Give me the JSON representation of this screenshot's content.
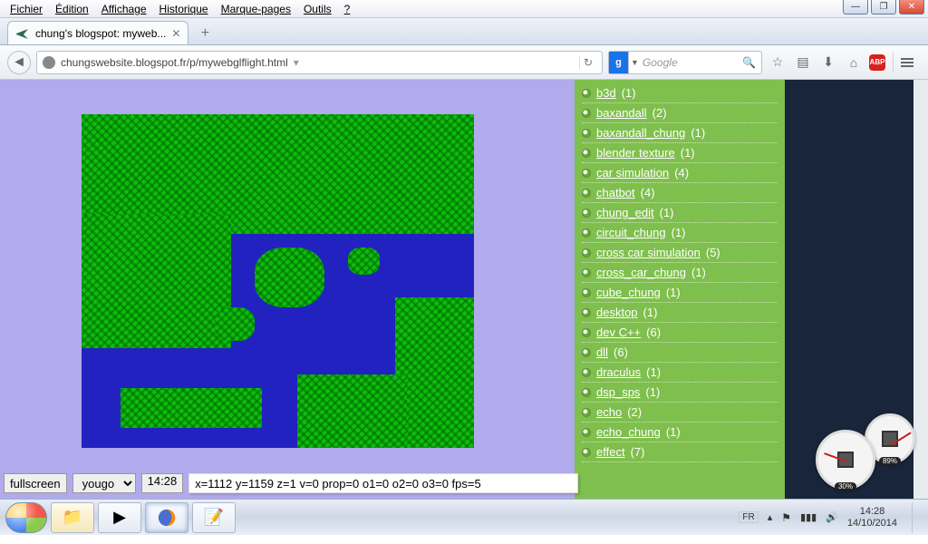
{
  "window": {
    "menus": [
      "Fichier",
      "Édition",
      "Affichage",
      "Historique",
      "Marque-pages",
      "Outils",
      "?"
    ]
  },
  "tab": {
    "title": "chung's blogspot: myweb..."
  },
  "nav": {
    "url": "chungswebsite.blogspot.fr/p/mywebglflight.html",
    "search_placeholder": "Google",
    "search_engine": "g"
  },
  "page": {
    "controls": {
      "fullscreen_label": "fullscreen",
      "select_value": "yougo",
      "time": "14:28",
      "status": "x=1112 y=1159 z=1 v=0 prop=0 o1=0 o2=0 o3=0 fps=5"
    },
    "categories": [
      {
        "label": "b3d",
        "count": "(1)"
      },
      {
        "label": "baxandall",
        "count": "(2)"
      },
      {
        "label": "baxandall_chung",
        "count": "(1)"
      },
      {
        "label": "blender texture",
        "count": "(1)"
      },
      {
        "label": "car simulation",
        "count": "(4)"
      },
      {
        "label": "chatbot",
        "count": "(4)"
      },
      {
        "label": "chung_edit",
        "count": "(1)"
      },
      {
        "label": "circuit_chung",
        "count": "(1)"
      },
      {
        "label": "cross car simulation",
        "count": "(5)"
      },
      {
        "label": "cross_car_chung",
        "count": "(1)"
      },
      {
        "label": "cube_chung",
        "count": "(1)"
      },
      {
        "label": "desktop",
        "count": "(1)"
      },
      {
        "label": "dev C++",
        "count": "(6)"
      },
      {
        "label": "dll",
        "count": "(6)"
      },
      {
        "label": "draculus",
        "count": "(1)"
      },
      {
        "label": "dsp_sps",
        "count": "(1)"
      },
      {
        "label": "echo",
        "count": "(2)"
      },
      {
        "label": "echo_chung",
        "count": "(1)"
      },
      {
        "label": "effect",
        "count": "(7)"
      }
    ],
    "gadget": {
      "big": "30%",
      "small": "89%"
    }
  },
  "taskbar": {
    "lang": "FR",
    "time": "14:28",
    "date": "14/10/2014"
  }
}
